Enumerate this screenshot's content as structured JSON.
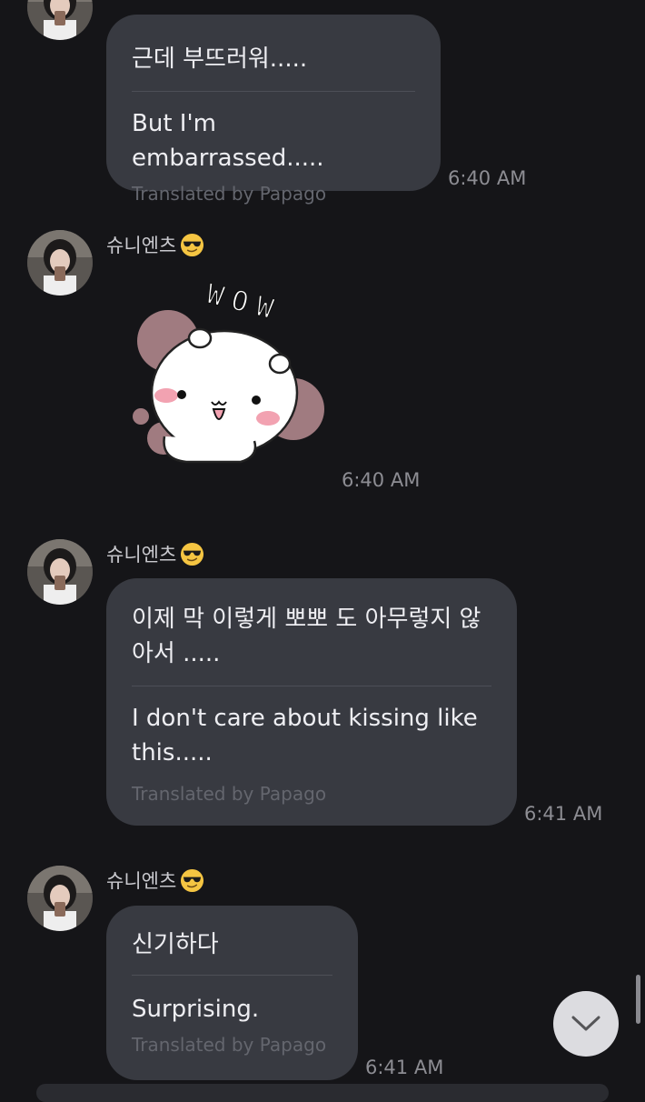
{
  "messages": [
    {
      "original": "근데 부뜨러워.....",
      "translation": "But I'm embarrassed.....",
      "credit": "Translated by Papago",
      "time": "6:40 AM"
    },
    {
      "sender": "슈니엔츠",
      "sender_emoji": "sunglasses-emoji",
      "sticker_text": "WOW",
      "time": "6:40 AM"
    },
    {
      "sender": "슈니엔츠",
      "sender_emoji": "sunglasses-emoji",
      "original": "이제 막 이렇게 뽀뽀 도 아무렇지 않\n아서 .....",
      "translation": "I don't care about kissing like\nthis.....",
      "credit": "Translated by Papago",
      "time": "6:41 AM"
    },
    {
      "sender": "슈니엔츠",
      "sender_emoji": "sunglasses-emoji",
      "original": "신기하다",
      "translation": "Surprising.",
      "credit": "Translated by Papago",
      "time": "6:41 AM"
    }
  ],
  "icons": {
    "scroll_down": "chevron-down-icon"
  },
  "colors": {
    "background": "#151518",
    "bubble": "#383a41",
    "sticker_blush": "#b98d93"
  }
}
